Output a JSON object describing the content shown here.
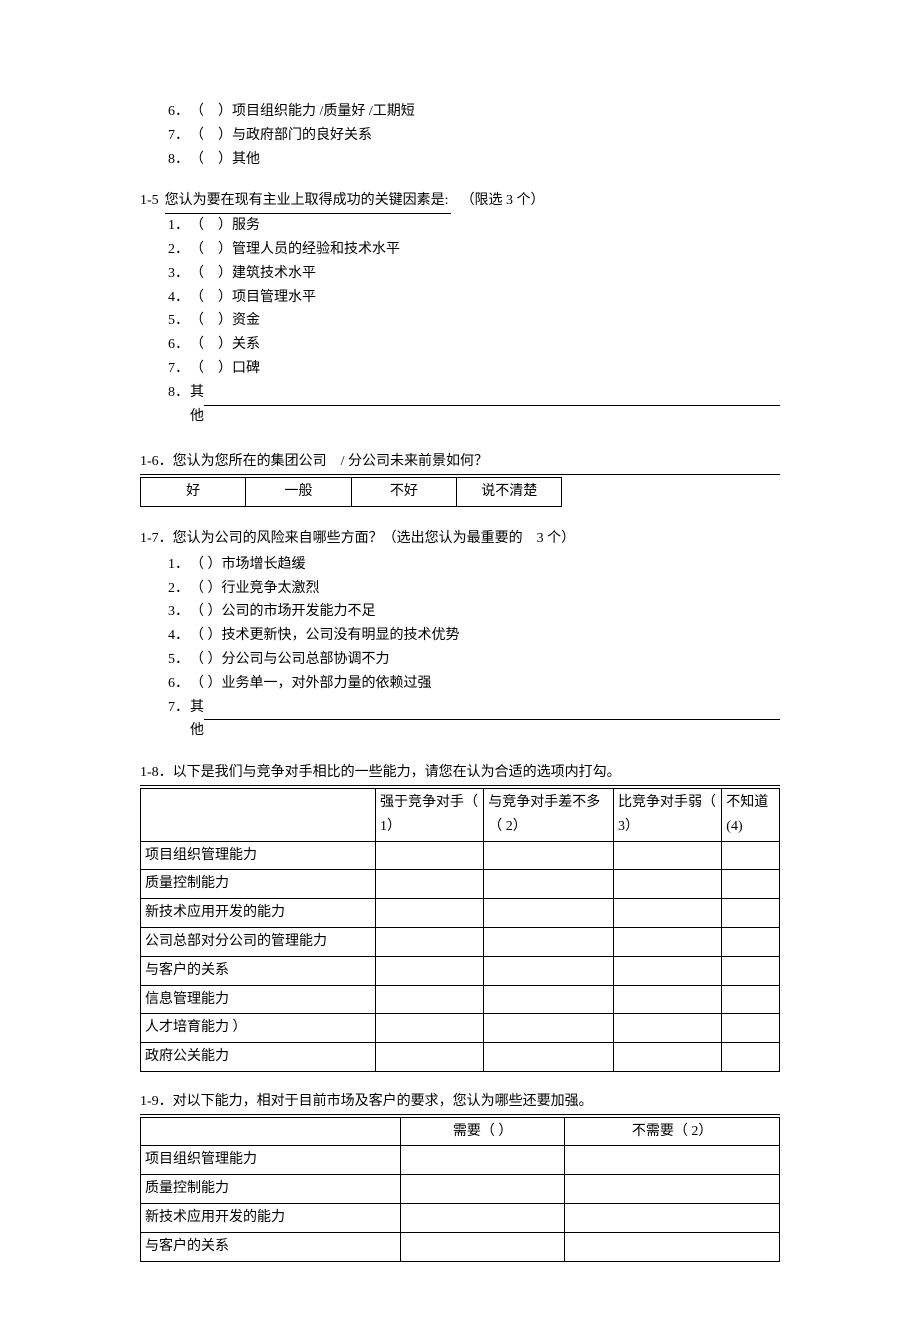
{
  "q14_tail": {
    "opts": [
      {
        "n": "6．",
        "t": "（　）项目组织能力 /质量好 /工期短"
      },
      {
        "n": "7．",
        "t": "（　）与政府部门的良好关系"
      },
      {
        "n": "8．",
        "t": "（　）其他"
      }
    ]
  },
  "q15": {
    "num": "1-5",
    "prompt": "您认为要在现有主业上取得成功的关键因素是:",
    "note": "（限选 3 个）",
    "opts": [
      {
        "n": "1．",
        "t": "（　）服务"
      },
      {
        "n": "2．",
        "t": "（　）管理人员的经验和技术水平"
      },
      {
        "n": "3．",
        "t": "（　）建筑技术水平"
      },
      {
        "n": "4．",
        "t": "（　）项目管理水平"
      },
      {
        "n": "5．",
        "t": "（　）资金"
      },
      {
        "n": "6．",
        "t": "（　）关系"
      },
      {
        "n": "7．",
        "t": "（　）口碑"
      },
      {
        "n": "8．",
        "t": "其他"
      }
    ]
  },
  "q16": {
    "prompt": "1-6．您认为您所在的集团公司　/ 分公司未来前景如何？",
    "cells": [
      "好",
      "一般",
      "不好",
      "说不清楚"
    ]
  },
  "q17": {
    "prompt": "1-7．您认为公司的风险来自哪些方面？（选出您认为最重要的　3 个）",
    "opts": [
      {
        "n": "1．",
        "t": "（ ）市场增长趋缓"
      },
      {
        "n": "2．",
        "t": "（ ）行业竞争太激烈"
      },
      {
        "n": "3．",
        "t": "（ ）公司的市场开发能力不足"
      },
      {
        "n": "4．",
        "t": "（ ）技术更新快，公司没有明显的技术优势"
      },
      {
        "n": "5．",
        "t": "（ ）分公司与公司总部协调不力"
      },
      {
        "n": "6．",
        "t": "（ ）业务单一，对外部力量的依赖过强"
      },
      {
        "n": "7．",
        "t": "其他"
      }
    ]
  },
  "q18": {
    "prompt": "1-8．以下是我们与竞争对手相比的一些能力，请您在认为合适的选项内打勾。",
    "headers": [
      "",
      "强于竞争对手（ 1）",
      "与竞争对手差不多（ 2）",
      "比竞争对手弱（ 3）",
      "不知道(4)"
    ],
    "rows": [
      "项目组织管理能力",
      "质量控制能力",
      "新技术应用开发的能力",
      "公司总部对分公司的管理能力",
      "与客户的关系",
      "信息管理能力",
      "人才培育能力 ）",
      "政府公关能力"
    ]
  },
  "q19": {
    "prompt": "1-9．对以下能力，相对于目前市场及客户的要求，您认为哪些还要加强。",
    "headers": [
      "",
      "需要（ ）",
      "不需要（ 2）"
    ],
    "rows": [
      "项目组织管理能力",
      "质量控制能力",
      "新技术应用开发的能力",
      "与客户的关系"
    ]
  }
}
